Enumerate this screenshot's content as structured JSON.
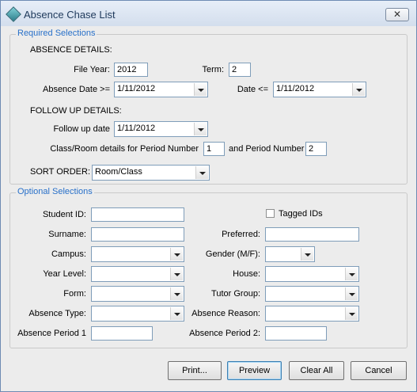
{
  "window": {
    "title": "Absence Chase List",
    "close_glyph": "✕",
    "icon": "app-diamond-icon"
  },
  "required": {
    "group_title": "Required Selections",
    "absence_details_heading": "ABSENCE DETAILS:",
    "file_year_label": "File Year:",
    "file_year_value": "2012",
    "term_label": "Term:",
    "term_value": "2",
    "absence_date_label": "Absence Date >=",
    "absence_date_value": "1/11/2012",
    "date_le_label": "Date <=",
    "date_le_value": "1/11/2012",
    "follow_up_heading": "FOLLOW UP DETAILS:",
    "follow_up_date_label": "Follow up date",
    "follow_up_date_value": "1/11/2012",
    "period_label": "Class/Room details for Period Number",
    "period_value": "1",
    "and_period_label": "and Period Number",
    "and_period_value": "2",
    "sort_order_label": "SORT ORDER:",
    "sort_order_value": "Room/Class"
  },
  "optional": {
    "group_title": "Optional Selections",
    "student_id_label": "Student ID:",
    "tagged_ids_label": "Tagged IDs",
    "surname_label": "Surname:",
    "preferred_label": "Preferred:",
    "campus_label": "Campus:",
    "gender_label": "Gender (M/F):",
    "year_level_label": "Year Level:",
    "house_label": "House:",
    "form_label": "Form:",
    "tutor_group_label": "Tutor Group:",
    "absence_type_label": "Absence Type:",
    "absence_reason_label": "Absence Reason:",
    "absence_period1_label": "Absence Period 1",
    "absence_period2_label": "Absence Period 2:"
  },
  "buttons": {
    "print": "Print...",
    "preview": "Preview",
    "clear_all": "Clear All",
    "cancel": "Cancel"
  }
}
